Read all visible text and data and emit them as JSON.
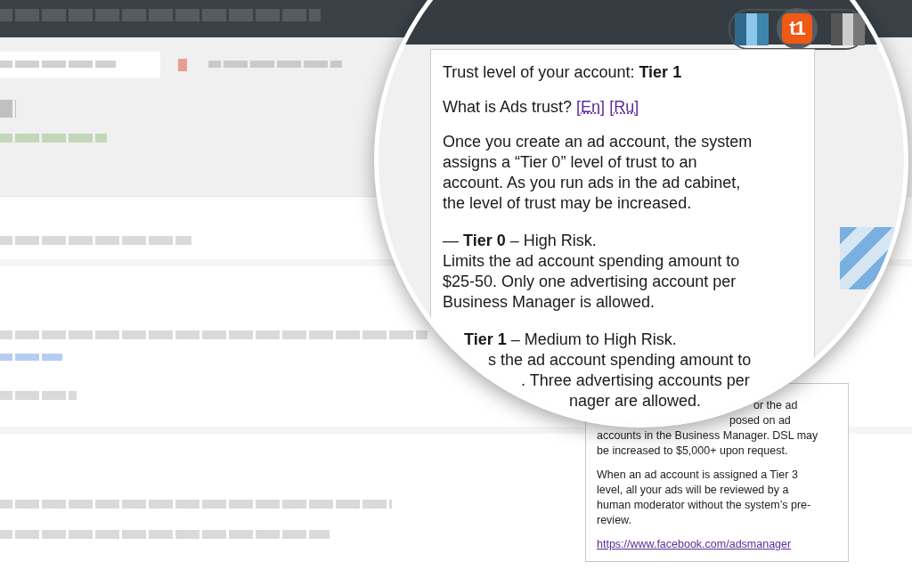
{
  "browser_toolbar": {
    "extension_badge": "t1"
  },
  "magnified_popup": {
    "title": "Trust level of your account: **Tier 1**",
    "question": "What is Ads trust?",
    "links": [
      "[En]",
      "[Ru]"
    ],
    "paragraphs": [
      {
        "lines": [
          "Once you create an ad account, the system",
          "assigns a “Tier 0” level of trust to an",
          "account. As you run ads in the ad cabinet,",
          "the level of trust may be increased."
        ]
      },
      {
        "lines": [
          "— **Tier 0** – High Risk.",
          "Limits the ad account spending amount to",
          "$25-50. Only one advertising account per",
          "Business Manager is allowed."
        ]
      },
      {
        "lines": [
          "**Tier 1** – Medium to High Risk.",
          "s the ad account spending amount to",
          ". Three advertising accounts per",
          "nager are allowed."
        ]
      }
    ]
  },
  "popup": {
    "paragraphs": [
      {
        "lines": [
          "or the ad",
          "posed on ad",
          "accounts in the Business Manager. DSL may",
          "be increased to $5,000+ upon request."
        ]
      },
      {
        "lines": [
          "When an ad account is assigned a Tier 3",
          "level, all your ads will be reviewed by a",
          "human moderator without the system’s pre-",
          "review."
        ]
      }
    ],
    "link": "https://www.facebook.com/adsmanager"
  }
}
